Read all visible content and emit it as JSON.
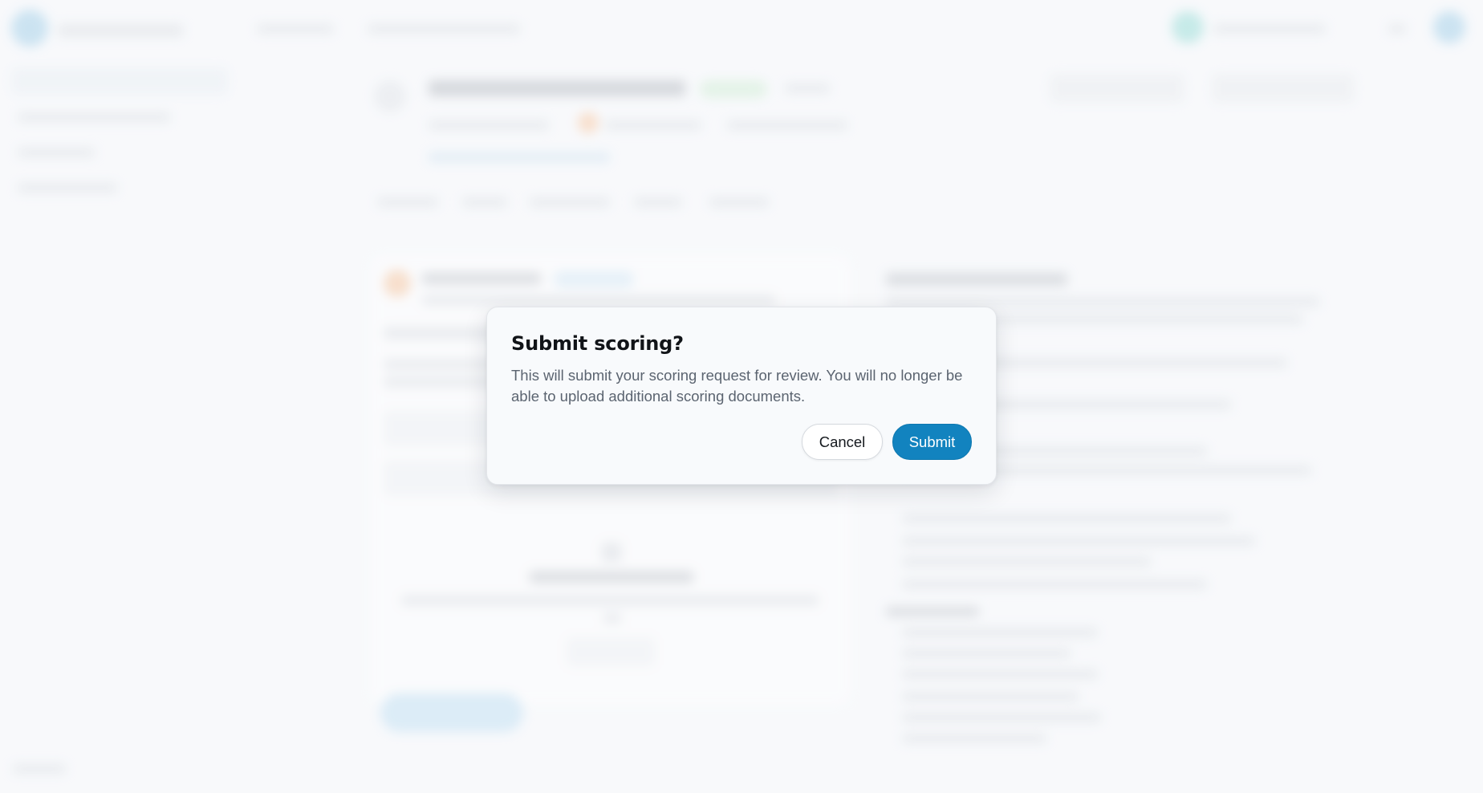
{
  "dialog": {
    "title": "Submit scoring?",
    "message": "This will submit your scoring request for review. You will no longer be able to upload additional scoring documents.",
    "cancel_label": "Cancel",
    "submit_label": "Submit"
  },
  "colors": {
    "primary": "#1283bf",
    "dialog_background": "#f8fafc",
    "page_background": "#f7f9fb"
  }
}
